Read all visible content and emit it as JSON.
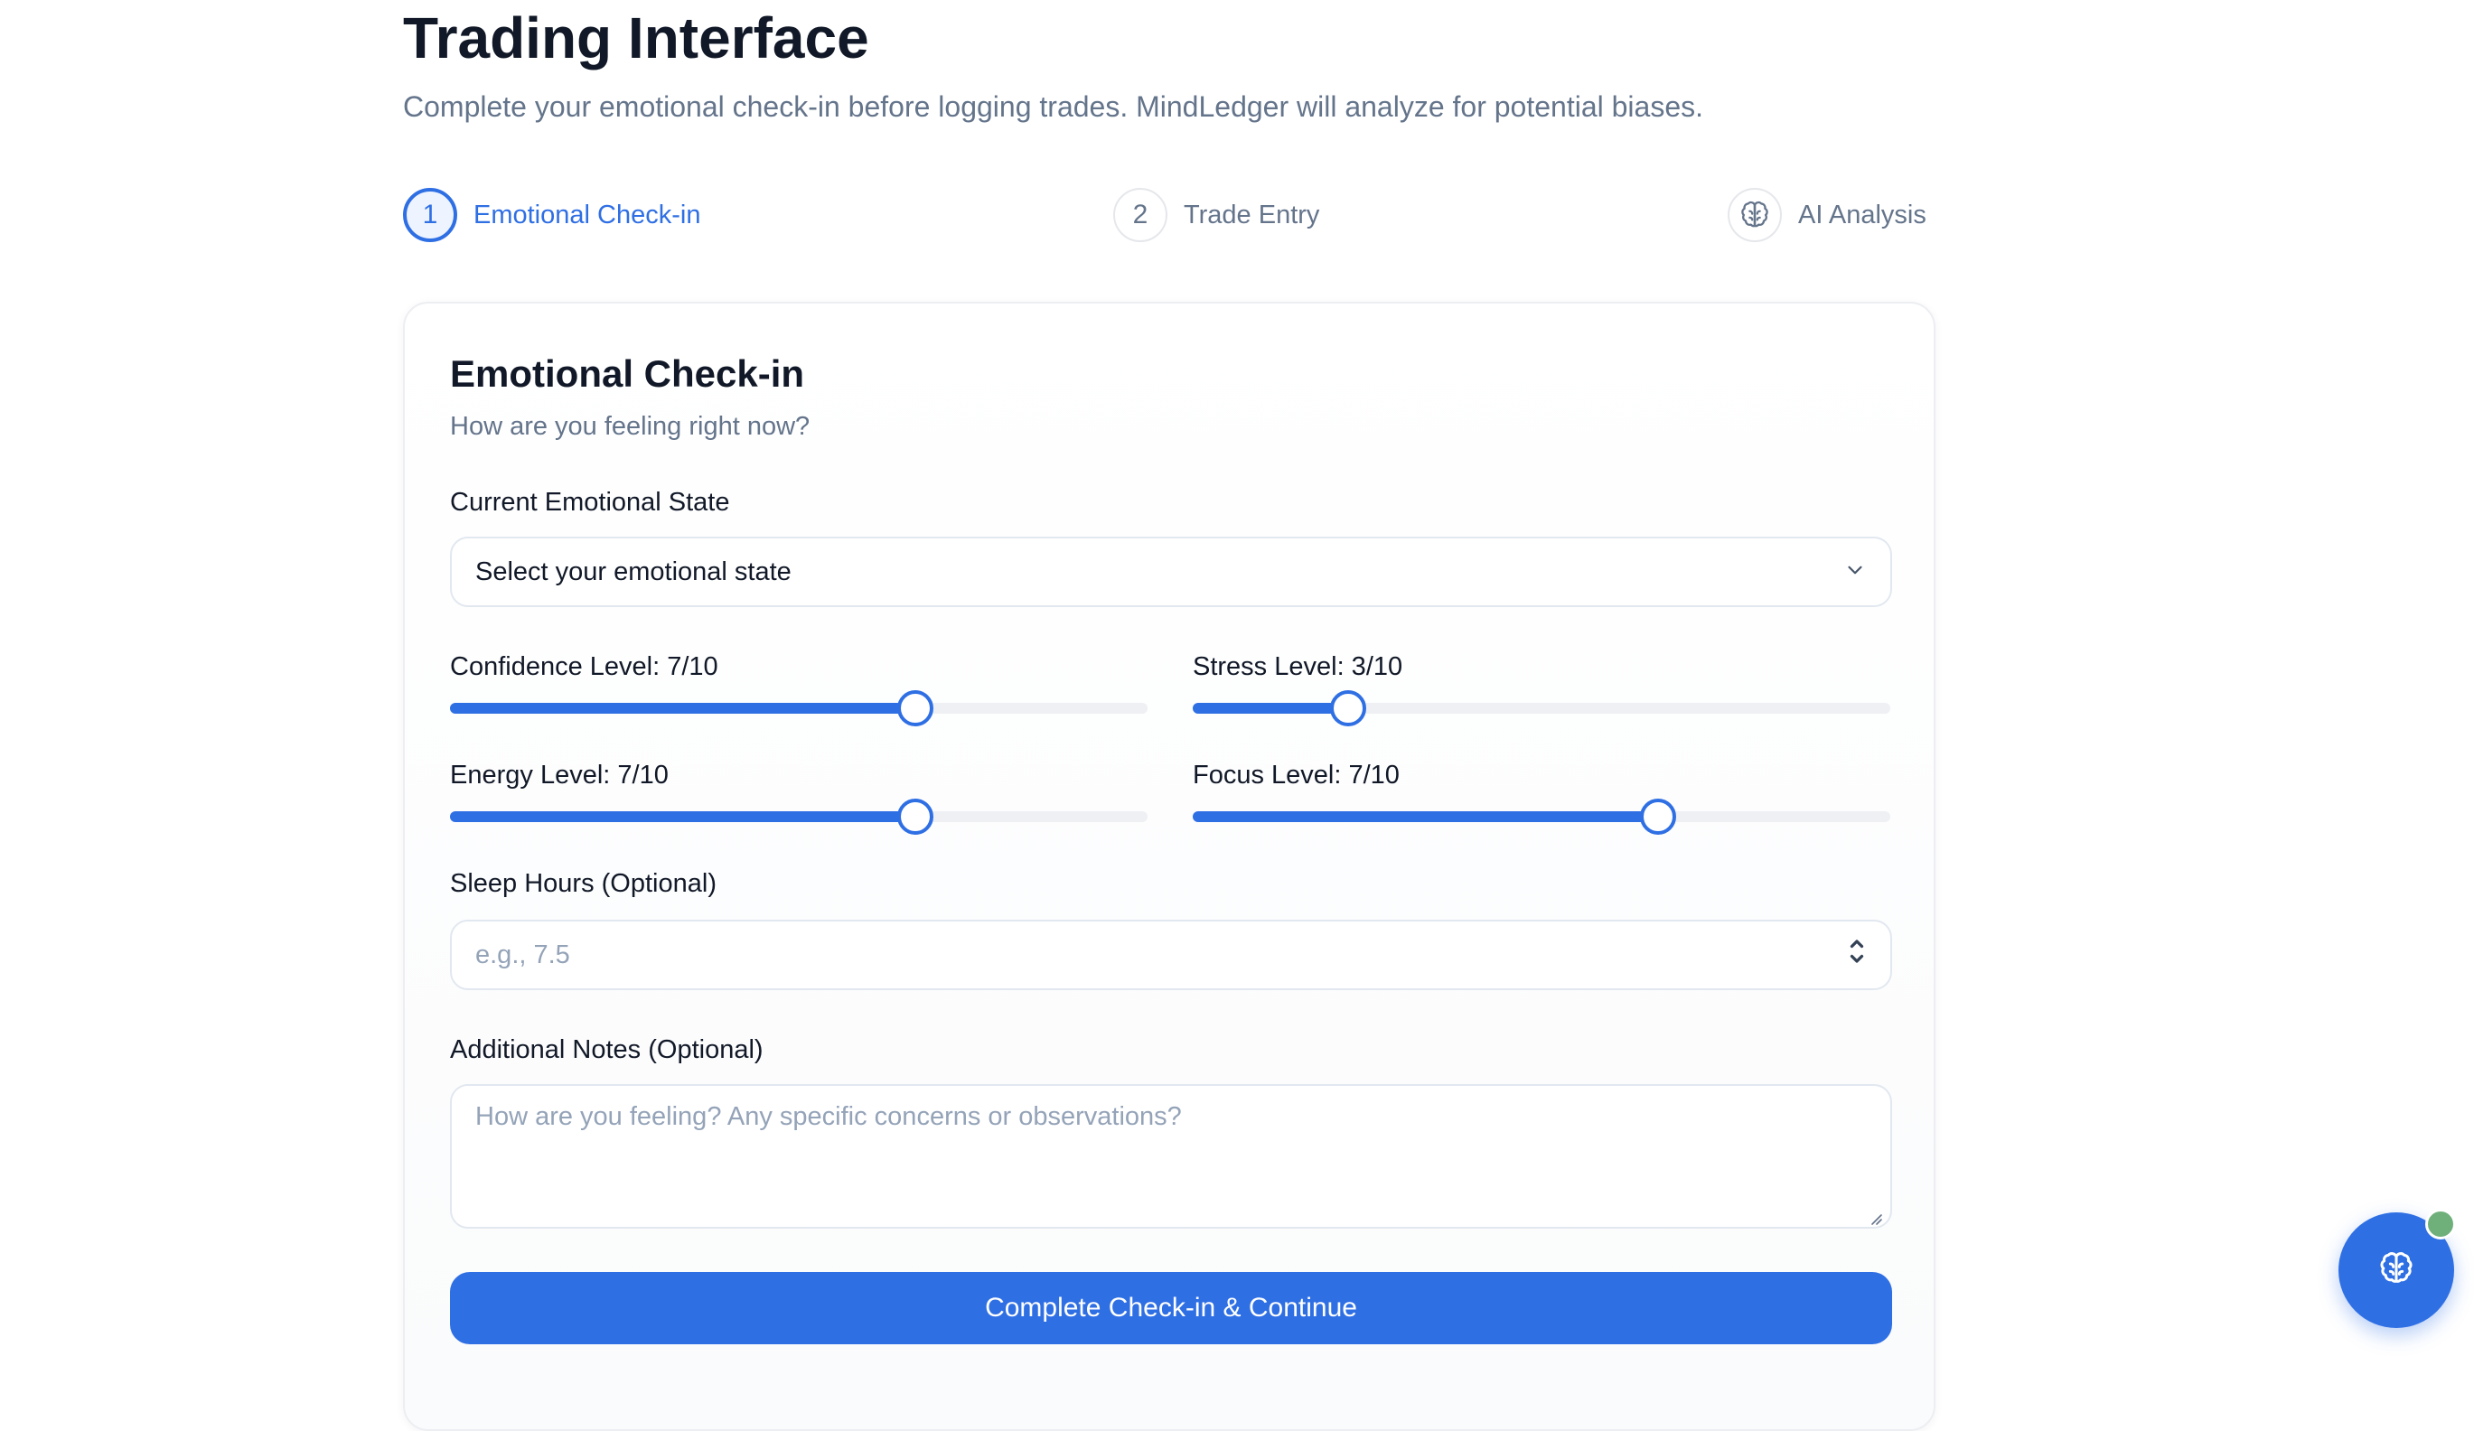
{
  "header": {
    "title": "Trading Interface",
    "subtitle": "Complete your emotional check-in before logging trades. MindLedger will analyze for potential biases."
  },
  "steps": [
    {
      "number": "1",
      "label": "Emotional Check-in",
      "active": true
    },
    {
      "number": "2",
      "label": "Trade Entry",
      "active": false
    },
    {
      "icon": "brain-icon",
      "label": "AI Analysis",
      "active": false
    }
  ],
  "card": {
    "title": "Emotional Check-in",
    "subtitle": "How are you feeling right now?"
  },
  "emotional_state": {
    "label": "Current Emotional State",
    "value": "Select your emotional state",
    "icon": "chevron-down-icon"
  },
  "sliders": {
    "confidence": {
      "label": "Confidence Level: 7/10",
      "value": 7,
      "max": 10
    },
    "stress": {
      "label": "Stress Level: 3/10",
      "value": 3,
      "max": 10
    },
    "energy": {
      "label": "Energy Level: 7/10",
      "value": 7,
      "max": 10
    },
    "focus": {
      "label": "Focus Level: 7/10",
      "value": 7,
      "max": 10
    }
  },
  "sleep": {
    "label": "Sleep Hours (Optional)",
    "placeholder": "e.g., 7.5"
  },
  "notes": {
    "label": "Additional Notes (Optional)",
    "placeholder": "How are you feeling? Any specific concerns or observations?"
  },
  "submit": {
    "label": "Complete Check-in & Continue"
  },
  "assistant": {
    "icon": "brain-icon",
    "status_color": "#6fb07a"
  },
  "colors": {
    "accent": "#2f6fe4",
    "muted_text": "#64748b",
    "border": "#e2e8f0"
  }
}
